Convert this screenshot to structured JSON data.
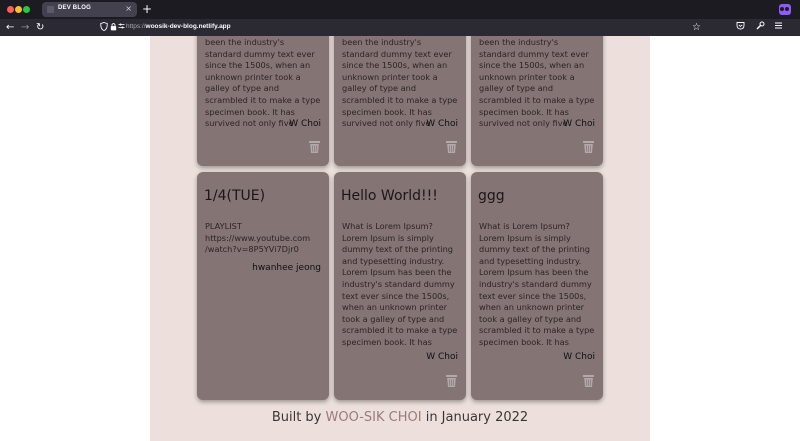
{
  "browser": {
    "tab_title": "DEV BLOG",
    "tab_close": "×",
    "new_tab": "+",
    "url_protocol": "https://",
    "url_host": "woosik-dev-blog.netlify.app"
  },
  "icons": {
    "back": "back-arrow-icon",
    "forward": "forward-arrow-icon",
    "reload": "reload-icon",
    "shield": "shield-icon",
    "lock": "lock-icon",
    "permissions": "permissions-icon",
    "bookmark": "star-icon",
    "pocket": "pocket-icon",
    "tools": "wrench-icon",
    "menu": "hamburger-menu-icon",
    "trash": "trash-icon"
  },
  "colors": {
    "page_bg": "#ede0dc",
    "card_bg": "#847474",
    "accent_link": "#9a7b78"
  },
  "cards_row1": [
    {
      "body": "been the industry's standard dummy text ever since the 1500s, when an unknown printer took a galley of type and scrambled it to make a type specimen book. It has survived not only five",
      "author": "W Choi"
    },
    {
      "body": "been the industry's standard dummy text ever since the 1500s, when an unknown printer took a galley of type and scrambled it to make a type specimen book. It has survived not only five",
      "author": "W Choi"
    },
    {
      "body": "been the industry's standard dummy text ever since the 1500s, when an unknown printer took a galley of type and scrambled it to make a type specimen book. It has survived not only five",
      "author": "W Choi"
    }
  ],
  "cards_row2": [
    {
      "title": "1/4(TUE)",
      "body": "PLAYLIST https://www.youtube.com /watch?v=8P5YVi7Djr0",
      "author": "hwanhee jeong"
    },
    {
      "title": "Hello World!!!",
      "body": "What is Lorem Ipsum? Lorem Ipsum is simply dummy text of the printing and typesetting industry. Lorem Ipsum has been the industry's standard dummy text ever since the 1500s, when an unknown printer took a galley of type and scrambled it to make a type specimen book. It has survived not only five",
      "author": "W Choi"
    },
    {
      "title": "ggg",
      "body": "What is Lorem Ipsum? Lorem Ipsum is simply dummy text of the printing and typesetting industry. Lorem Ipsum has been the industry's standard dummy text ever since the 1500s, when an unknown printer took a galley of type and scrambled it to make a type specimen book. It has survived not only five",
      "author": "W Choi"
    }
  ],
  "footer": {
    "prefix": "Built by",
    "author": "WOO-SIK CHOI",
    "suffix": "in January 2022"
  }
}
